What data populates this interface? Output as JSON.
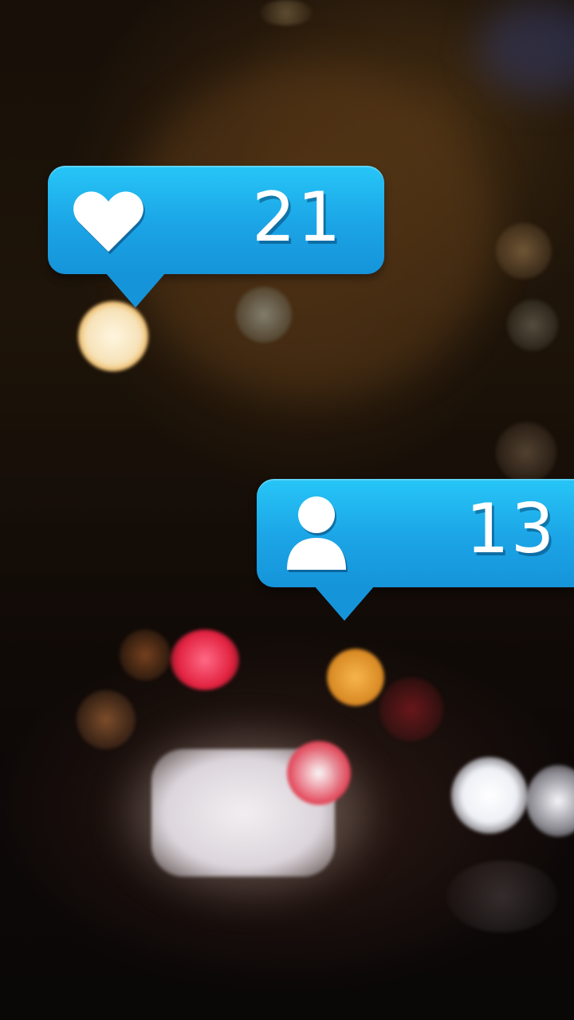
{
  "notifications": [
    {
      "type": "likes",
      "icon": "heart-icon",
      "count": "21",
      "color": "#1ba4e6"
    },
    {
      "type": "followers",
      "icon": "person-icon",
      "count": "13",
      "color": "#1ba4e6"
    }
  ],
  "background": {
    "description_colors": [
      "#1e1409",
      "#0a0707"
    ]
  }
}
